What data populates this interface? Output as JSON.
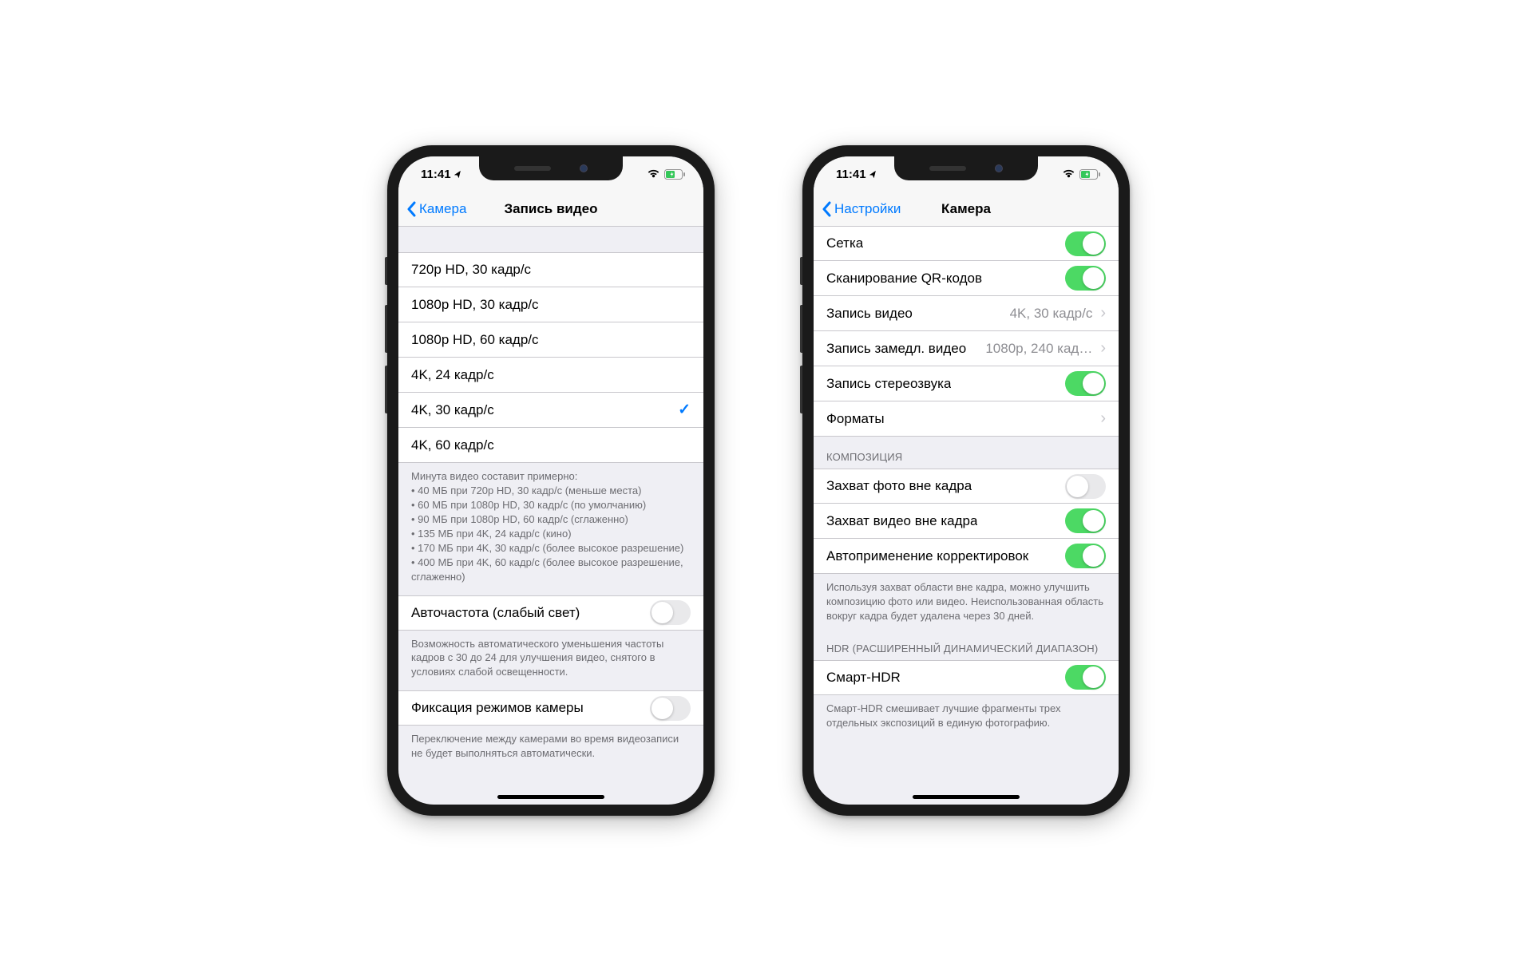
{
  "status": {
    "time": "11:41"
  },
  "phone1": {
    "back": "Камера",
    "title": "Запись видео",
    "options": [
      {
        "label": "720p HD, 30 кадр/с",
        "selected": false
      },
      {
        "label": "1080p HD, 30 кадр/с",
        "selected": false
      },
      {
        "label": "1080p HD, 60 кадр/с",
        "selected": false
      },
      {
        "label": "4K, 24 кадр/с",
        "selected": false
      },
      {
        "label": "4K, 30 кадр/с",
        "selected": true
      },
      {
        "label": "4K, 60 кадр/с",
        "selected": false
      }
    ],
    "footer1_intro": "Минута видео составит примерно:",
    "footer1_lines": [
      "• 40 МБ при 720p HD, 30 кадр/с (меньше места)",
      "• 60 МБ при 1080p HD, 30 кадр/с (по умолчанию)",
      "• 90 МБ при 1080p HD, 60 кадр/с (сглаженно)",
      "• 135 МБ при 4K, 24 кадр/с (кино)",
      "• 170 МБ при 4K, 30 кадр/с (более высокое разрешение)",
      "• 400 МБ при 4K, 60 кадр/с (более высокое разрешение, сглаженно)"
    ],
    "auto_fps_label": "Авточастота (слабый свет)",
    "auto_fps_on": false,
    "footer2": "Возможность автоматического уменьшения частоты кадров с 30 до 24 для улучшения видео, снятого в условиях слабой освещенности.",
    "lock_label": "Фиксация режимов камеры",
    "lock_on": false,
    "footer3": "Переключение между камерами во время видеозаписи не будет выполняться автоматически."
  },
  "phone2": {
    "back": "Настройки",
    "title": "Камера",
    "rows_top": [
      {
        "label": "Сетка",
        "type": "toggle",
        "on": true
      },
      {
        "label": "Сканирование QR-кодов",
        "type": "toggle",
        "on": true
      },
      {
        "label": "Запись видео",
        "type": "link",
        "detail": "4K, 30 кадр/с"
      },
      {
        "label": "Запись замедл. видео",
        "type": "link",
        "detail": "1080p, 240 кад…"
      },
      {
        "label": "Запись стереозвука",
        "type": "toggle",
        "on": true
      },
      {
        "label": "Форматы",
        "type": "link",
        "detail": ""
      }
    ],
    "section_comp": "КОМПОЗИЦИЯ",
    "rows_comp": [
      {
        "label": "Захват фото вне кадра",
        "on": false
      },
      {
        "label": "Захват видео вне кадра",
        "on": true
      },
      {
        "label": "Автоприменение корректировок",
        "on": true
      }
    ],
    "footer_comp": "Используя захват области вне кадра, можно улучшить композицию фото или видео. Неиспользованная область вокруг кадра будет удалена через 30 дней.",
    "section_hdr": "HDR (РАСШИРЕННЫЙ ДИНАМИЧЕСКИЙ ДИАПАЗОН)",
    "smart_hdr_label": "Смарт-HDR",
    "smart_hdr_on": true,
    "footer_hdr": "Смарт-HDR смешивает лучшие фрагменты трех отдельных экспозиций в единую фотографию."
  }
}
